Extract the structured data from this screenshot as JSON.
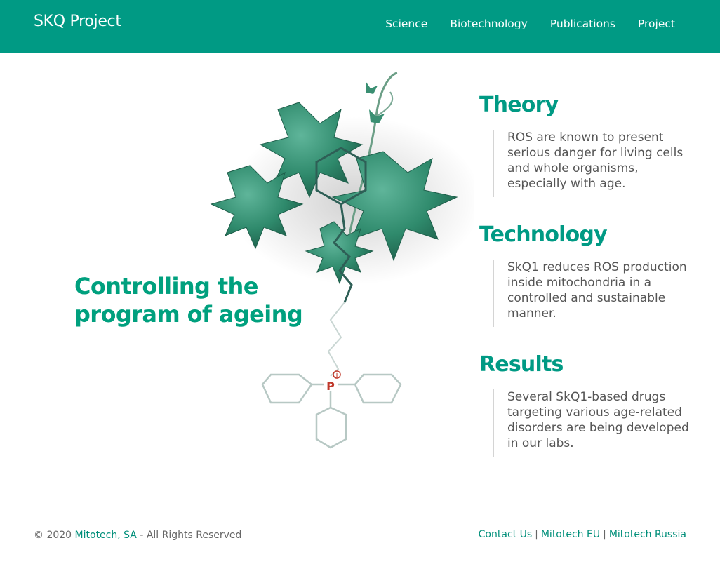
{
  "header": {
    "brand": "SKQ Project",
    "nav": [
      "Science",
      "Biotechnology",
      "Publications",
      "Project"
    ]
  },
  "hero": {
    "title_line1": "Controlling the",
    "title_line2": "program of ageing",
    "molecule_atom": "P",
    "molecule_charge": "+"
  },
  "sections": [
    {
      "title": "Theory",
      "text": "ROS are known to present serious danger for living cells and whole organisms, especially with age."
    },
    {
      "title": "Technology",
      "text": "SkQ1 reduces ROS production inside mitochondria in a controlled and sustainable manner."
    },
    {
      "title": "Results",
      "text": "Several SkQ1-based drugs targeting various age-related disorders are being developed in our labs."
    }
  ],
  "footer": {
    "copyright": "© 2020",
    "company": "Mitotech, SA",
    "rights": "- All Rights Reserved",
    "links": [
      "Contact Us",
      "Mitotech EU",
      "Mitotech Russia"
    ],
    "separator": "|"
  },
  "colors": {
    "brand": "#009a84",
    "accent_text": "#00a07e"
  }
}
